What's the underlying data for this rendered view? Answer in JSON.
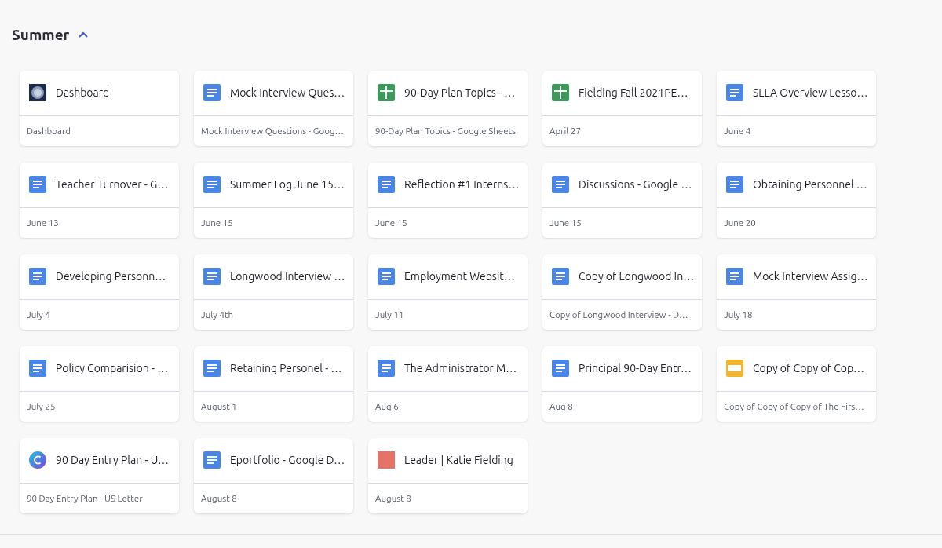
{
  "section": {
    "title": "Summer",
    "expanded": true
  },
  "items": [
    {
      "kind": "site",
      "title": "Dashboard",
      "subtitle": "Dashboard"
    },
    {
      "kind": "doc",
      "title": "Mock Interview Ques…",
      "subtitle": "Mock Interview Questions - Goog…"
    },
    {
      "kind": "sheet",
      "title": "90-Day Plan Topics - …",
      "subtitle": "90-Day Plan Topics - Google Sheets"
    },
    {
      "kind": "sheet",
      "title": "Fielding Fall 2021PE…",
      "subtitle": "April 27"
    },
    {
      "kind": "doc",
      "title": "SLLA Overview Lesso…",
      "subtitle": "June 4"
    },
    {
      "kind": "doc",
      "title": "Teacher Turnover - G…",
      "subtitle": "June 13"
    },
    {
      "kind": "doc",
      "title": "Summer Log June 15…",
      "subtitle": "June 15"
    },
    {
      "kind": "doc",
      "title": "Reflection #1 Interns…",
      "subtitle": "June 15"
    },
    {
      "kind": "doc",
      "title": "Discussions - Google …",
      "subtitle": "June 15"
    },
    {
      "kind": "doc",
      "title": "Obtaining Personnel …",
      "subtitle": "June 20"
    },
    {
      "kind": "doc",
      "title": "Developing Personn…",
      "subtitle": "July 4"
    },
    {
      "kind": "doc",
      "title": "Longwood Interview …",
      "subtitle": "July 4th"
    },
    {
      "kind": "doc",
      "title": "Employment Websit…",
      "subtitle": "July 11"
    },
    {
      "kind": "doc",
      "title": "Copy of Longwood In…",
      "subtitle": "Copy of Longwood Interview - D…"
    },
    {
      "kind": "doc",
      "title": "Mock Interview Assig…",
      "subtitle": "July 18"
    },
    {
      "kind": "doc",
      "title": "Policy Comparision - …",
      "subtitle": "July 25"
    },
    {
      "kind": "doc",
      "title": "Retaining Personel - …",
      "subtitle": "August 1"
    },
    {
      "kind": "doc",
      "title": "The Administrator M…",
      "subtitle": "Aug 6"
    },
    {
      "kind": "doc",
      "title": "Principal 90-Day Entr…",
      "subtitle": "Aug 8"
    },
    {
      "kind": "slides",
      "title": "Copy of Copy of Cop…",
      "subtitle": "Copy of Copy of Copy of The Firs…"
    },
    {
      "kind": "canva",
      "title": "90 Day Entry Plan - U…",
      "subtitle": "90 Day Entry Plan - US Letter"
    },
    {
      "kind": "doc",
      "title": "Eportfolio - Google D…",
      "subtitle": "August 8"
    },
    {
      "kind": "swatch",
      "title": "Leader | Katie Fielding",
      "subtitle": "August 8"
    }
  ]
}
